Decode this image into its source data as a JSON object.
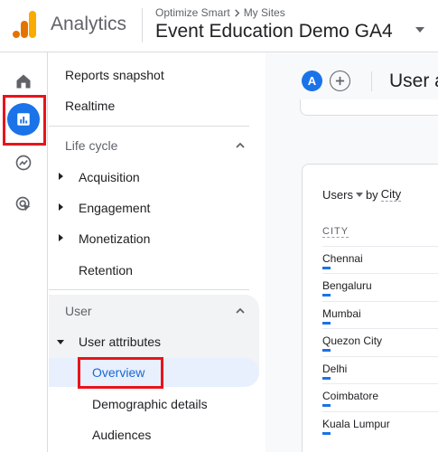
{
  "header": {
    "product_name": "Analytics",
    "breadcrumb": [
      "Optimize Smart",
      "My Sites"
    ],
    "property_name": "Event Education Demo GA4"
  },
  "rail": {
    "items": [
      {
        "icon": "home-icon",
        "active": false
      },
      {
        "icon": "reports-icon",
        "active": true
      },
      {
        "icon": "explore-icon",
        "active": false
      },
      {
        "icon": "advertising-icon",
        "active": false
      }
    ]
  },
  "nav": {
    "reports_snapshot": "Reports snapshot",
    "realtime": "Realtime",
    "lifecycle": {
      "title": "Life cycle",
      "items": [
        "Acquisition",
        "Engagement",
        "Monetization",
        "Retention"
      ]
    },
    "user": {
      "title": "User",
      "user_attributes": "User attributes",
      "sub_items": [
        "Overview",
        "Demographic details",
        "Audiences"
      ],
      "selected": "Overview"
    }
  },
  "main": {
    "avatar_letter": "A",
    "page_title": "User a",
    "card": {
      "metric": "Users",
      "by": "by",
      "dimension": "City",
      "column_header": "CITY",
      "rows": [
        "Chennai",
        "Bengaluru",
        "Mumbai",
        "Quezon City",
        "Delhi",
        "Coimbatore",
        "Kuala Lumpur"
      ]
    }
  },
  "colors": {
    "accent": "#1a73e8",
    "highlight": "#e8141b",
    "logo_orange": "#f9ab00",
    "logo_dark_orange": "#e37400"
  }
}
